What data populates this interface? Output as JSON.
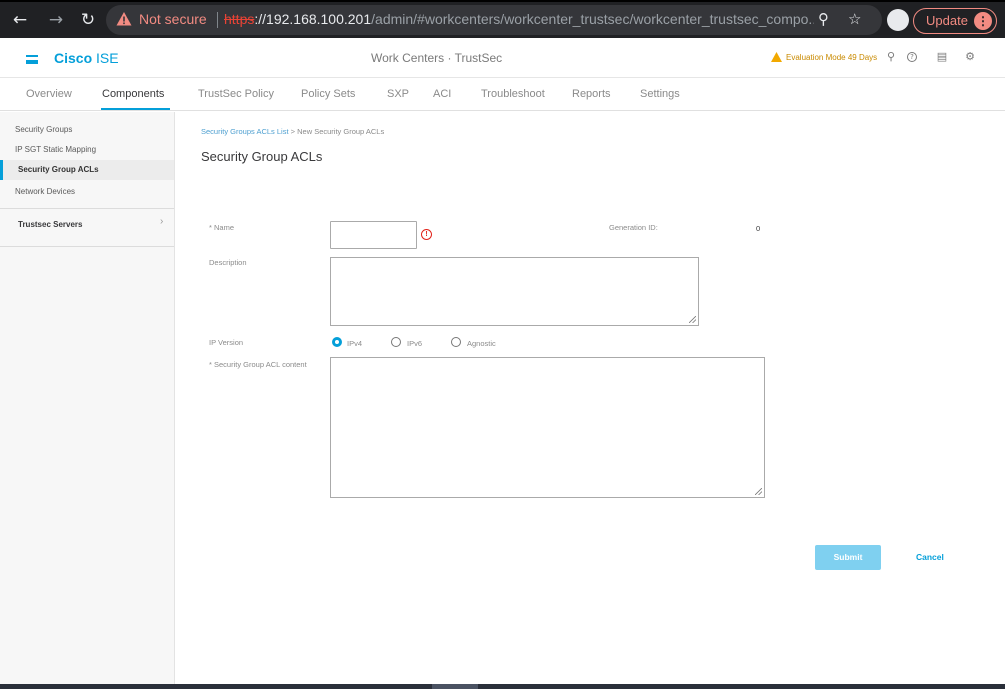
{
  "browser": {
    "not_secure": "Not secure",
    "url_scheme": "https",
    "url_host": "://192.168.100.201",
    "url_path": "/admin/#workcenters/workcenter_trustsec/workcenter_trustsec_compo...",
    "update_label": "Update"
  },
  "header": {
    "brand_bold": "Cisco",
    "brand_rest": " ISE",
    "title": "Work Centers · TrustSec",
    "evaluation": "Evaluation Mode 49 Days"
  },
  "tabs": [
    {
      "label": "Overview"
    },
    {
      "label": "Components"
    },
    {
      "label": "TrustSec Policy"
    },
    {
      "label": "Policy Sets"
    },
    {
      "label": "SXP"
    },
    {
      "label": "ACI"
    },
    {
      "label": "Troubleshoot"
    },
    {
      "label": "Reports"
    },
    {
      "label": "Settings"
    }
  ],
  "sidebar": {
    "items": [
      {
        "label": "Security Groups"
      },
      {
        "label": "IP SGT Static Mapping"
      },
      {
        "label": "Security Group ACLs"
      },
      {
        "label": "Network Devices"
      }
    ],
    "group": "Trustsec Servers"
  },
  "breadcrumb": {
    "link": "Security Groups ACLs List",
    "separator": " > ",
    "current": "New Security Group ACLs"
  },
  "page_title": "Security Group ACLs",
  "form": {
    "name_label": "* Name",
    "name_value": "",
    "generation_label": "Generation ID:",
    "generation_value": "0",
    "description_label": "Description",
    "description_value": "",
    "ip_version_label": "IP Version",
    "ip_options": [
      "IPv4",
      "IPv6",
      "Agnostic"
    ],
    "ip_selected": "IPv4",
    "acl_label": "* Security Group ACL content",
    "acl_value": "",
    "submit_label": "Submit",
    "cancel_label": "Cancel"
  },
  "colors": {
    "accent": "#049fd9",
    "error": "#e2231a",
    "warning": "#c98a00"
  }
}
